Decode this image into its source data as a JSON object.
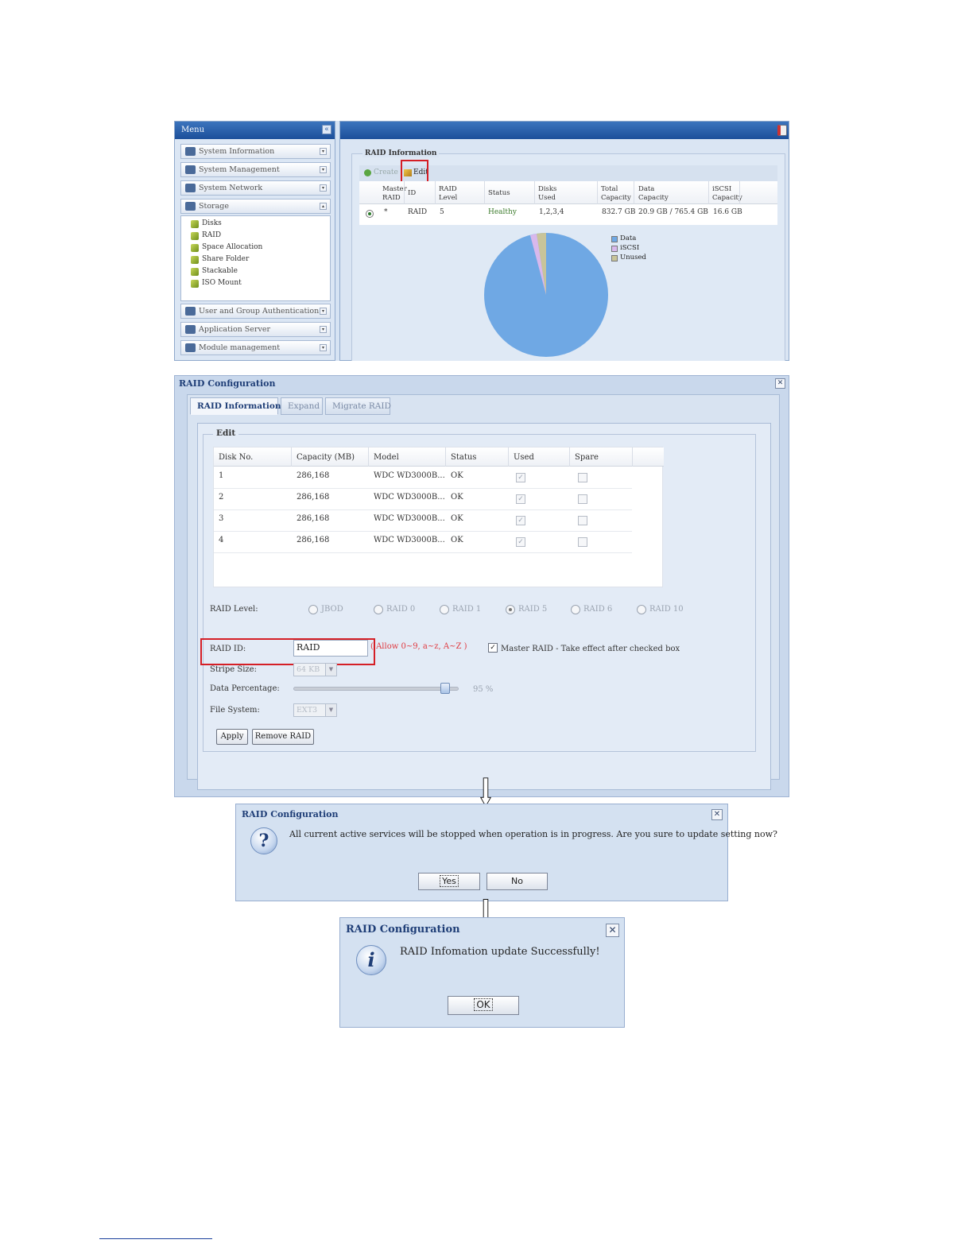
{
  "main_window": {
    "menu": {
      "title": "Menu",
      "collapse_label": "«",
      "categories_top": [
        {
          "label": "System Information",
          "icon": "info-book-icon"
        },
        {
          "label": "System Management",
          "icon": "wrench-icon"
        },
        {
          "label": "System Network",
          "icon": "network-icon"
        },
        {
          "label": "Storage",
          "icon": "storage-icon"
        }
      ],
      "storage_items": [
        "Disks",
        "RAID",
        "Space Allocation",
        "Share Folder",
        "Stackable",
        "ISO Mount"
      ],
      "categories_bottom": [
        {
          "label": "User and Group Authentication",
          "icon": "users-icon"
        },
        {
          "label": "Application Server",
          "icon": "app-server-icon"
        },
        {
          "label": "Module management",
          "icon": "module-icon"
        }
      ]
    },
    "raid_info": {
      "title": "RAID Information",
      "toolbar": {
        "create": "Create",
        "edit": "Edit"
      },
      "columns": [
        "Master RAID",
        "ID",
        "RAID Level",
        "Status",
        "Disks Used",
        "Total Capacity",
        "Data Capacity",
        "iSCSI Capacity"
      ],
      "row": {
        "master": "*",
        "id": "RAID",
        "level": "5",
        "status": "Healthy",
        "disks": "1,2,3,4",
        "total": "832.7 GB",
        "data": "20.9 GB / 765.4 GB",
        "iscsi": "16.6 GB"
      },
      "pie": {
        "legend": [
          {
            "name": "Data",
            "color": "#6fa8e4"
          },
          {
            "name": "iSCSI",
            "color": "#d8b8ec"
          },
          {
            "name": "Unused",
            "color": "#c8c49a"
          }
        ]
      }
    }
  },
  "raid_config": {
    "title": "RAID Configuration",
    "close_label": "✕",
    "tabs": [
      "RAID Information",
      "Expand",
      "Migrate RAID"
    ],
    "edit_legend": "Edit",
    "disk_columns": [
      "Disk No.",
      "Capacity (MB)",
      "Model",
      "Status",
      "Used",
      "Spare"
    ],
    "disks": [
      {
        "no": "1",
        "capacity": "286,168",
        "model": "WDC WD3000B...",
        "status": "OK"
      },
      {
        "no": "2",
        "capacity": "286,168",
        "model": "WDC WD3000B...",
        "status": "OK"
      },
      {
        "no": "3",
        "capacity": "286,168",
        "model": "WDC WD3000B...",
        "status": "OK"
      },
      {
        "no": "4",
        "capacity": "286,168",
        "model": "WDC WD3000B...",
        "status": "OK"
      }
    ],
    "raid_level_label": "RAID Level:",
    "raid_levels": [
      "JBOD",
      "RAID 0",
      "RAID 1",
      "RAID 5",
      "RAID 6",
      "RAID 10"
    ],
    "raid_level_selected": "RAID 5",
    "raid_id_label": "RAID ID:",
    "raid_id_value": "RAID",
    "raid_id_hint": "( Allow 0~9, a~z, A~Z )",
    "master_raid_label": "Master RAID - Take effect after checked box",
    "stripe_label": "Stripe Size:",
    "stripe_value": "64 KB",
    "data_pct_label": "Data Percentage:",
    "data_pct_value": "95 %",
    "fs_label": "File System:",
    "fs_value": "EXT3",
    "apply_label": "Apply",
    "remove_label": "Remove RAID"
  },
  "confirm_dialog": {
    "title": "RAID Configuration",
    "close_label": "✕",
    "message": "All current active services will be stopped when operation is in progress. Are you sure to update setting now?",
    "yes_label": "Yes",
    "no_label": "No",
    "icon": "question-icon"
  },
  "success_dialog": {
    "title": "RAID Configuration",
    "close_label": "✕",
    "message": "RAID Infomation update Successfully!",
    "ok_label": "OK",
    "icon": "info-icon"
  }
}
